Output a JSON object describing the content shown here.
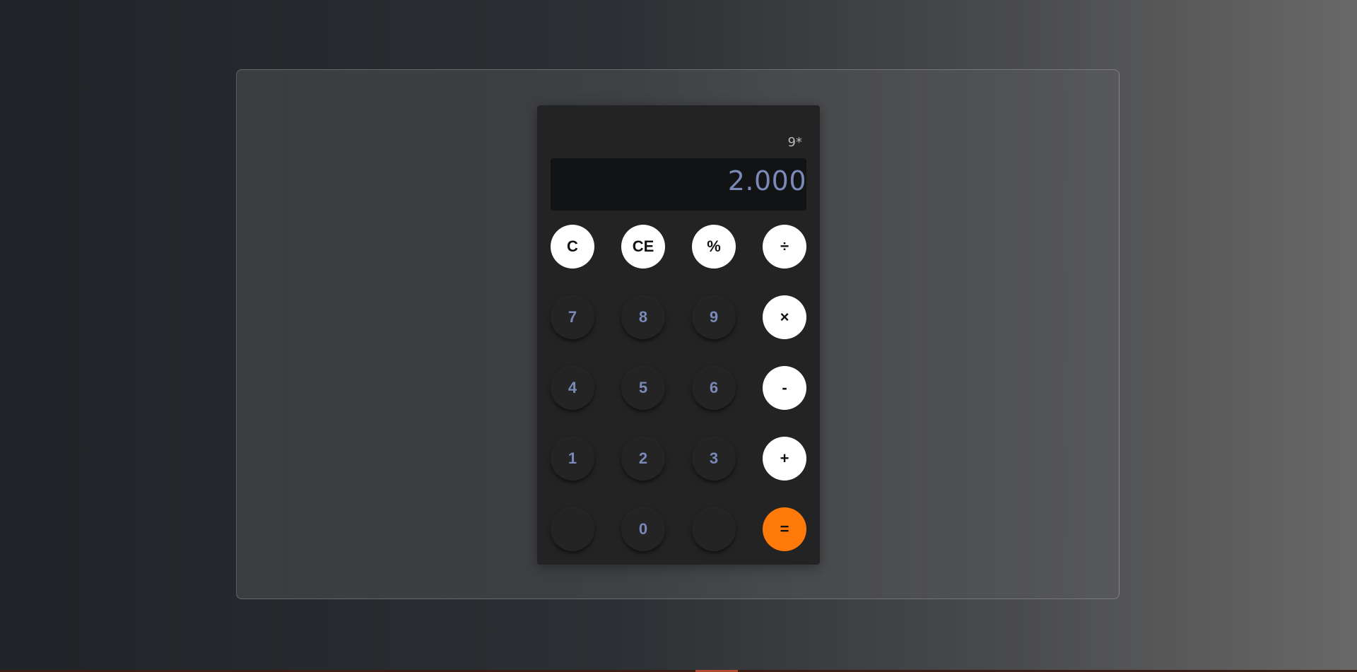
{
  "colors": {
    "accent": "#ff7a0a",
    "display_text": "#7a89b8",
    "calculator_body": "#232323",
    "display_bg": "#111314"
  },
  "calculator": {
    "expression": "9*",
    "display": "2.000",
    "keys": [
      {
        "label": "C",
        "style": "light"
      },
      {
        "label": "CE",
        "style": "light"
      },
      {
        "label": "%",
        "style": "light"
      },
      {
        "label": "÷",
        "style": "light"
      },
      {
        "label": "7",
        "style": "dark"
      },
      {
        "label": "8",
        "style": "dark"
      },
      {
        "label": "9",
        "style": "dark"
      },
      {
        "label": "×",
        "style": "light"
      },
      {
        "label": "4",
        "style": "dark"
      },
      {
        "label": "5",
        "style": "dark"
      },
      {
        "label": "6",
        "style": "dark"
      },
      {
        "label": "-",
        "style": "light"
      },
      {
        "label": "1",
        "style": "dark"
      },
      {
        "label": "2",
        "style": "dark"
      },
      {
        "label": "3",
        "style": "dark"
      },
      {
        "label": "+",
        "style": "light"
      },
      {
        "label": "",
        "style": "dark"
      },
      {
        "label": "0",
        "style": "dark"
      },
      {
        "label": "",
        "style": "dark"
      },
      {
        "label": "=",
        "style": "accent"
      }
    ]
  }
}
